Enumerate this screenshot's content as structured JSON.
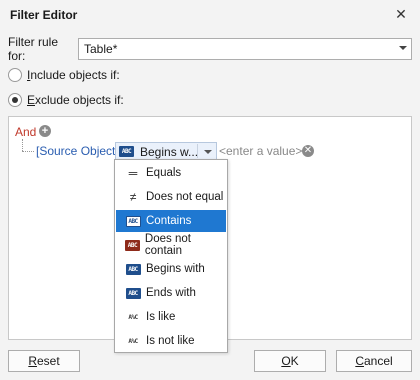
{
  "window": {
    "title": "Filter Editor",
    "close_glyph": "✕"
  },
  "filter_rule": {
    "label": "Filter rule for:",
    "value": "Table*"
  },
  "radios": [
    {
      "prefix": "",
      "mnemonic": "I",
      "rest": "nclude objects if:",
      "checked": false
    },
    {
      "prefix": "",
      "mnemonic": "E",
      "rest": "xclude objects if:",
      "checked": true
    }
  ],
  "editor": {
    "group_operator": "And",
    "add_icon": "plus-circle-icon",
    "condition": {
      "field": "[Source Object]",
      "operator": "Begins w...",
      "value_placeholder": "<enter a value>",
      "remove_icon": "x-circle-icon"
    }
  },
  "dropdown": {
    "items": [
      {
        "label": "Equals",
        "icon": "equals-icon",
        "glyph": "═",
        "selected": false
      },
      {
        "label": "Does not equal",
        "icon": "not-equal-icon",
        "glyph": "≠",
        "selected": false
      },
      {
        "label": "Contains",
        "icon": "contains-icon",
        "glyph": "ABC",
        "selected": true
      },
      {
        "label": "Does not contain",
        "icon": "does-not-contain-icon",
        "glyph": "ABC",
        "selected": false
      },
      {
        "label": "Begins with",
        "icon": "begins-with-icon",
        "glyph": "ABC",
        "selected": false
      },
      {
        "label": "Ends with",
        "icon": "ends-with-icon",
        "glyph": "ABC",
        "selected": false
      },
      {
        "label": "Is like",
        "icon": "is-like-icon",
        "glyph": "A%C",
        "selected": false
      },
      {
        "label": "Is not like",
        "icon": "is-not-like-icon",
        "glyph": "A%C",
        "selected": false
      }
    ]
  },
  "buttons": {
    "reset": {
      "mnemonic": "R",
      "rest": "eset"
    },
    "ok": {
      "mnemonic": "O",
      "rest": "K"
    },
    "cancel": {
      "mnemonic": "C",
      "rest": "ancel"
    }
  },
  "colors": {
    "accent": "#1f78d1",
    "group_operator": "#c0392b",
    "field": "#2a5db0"
  }
}
